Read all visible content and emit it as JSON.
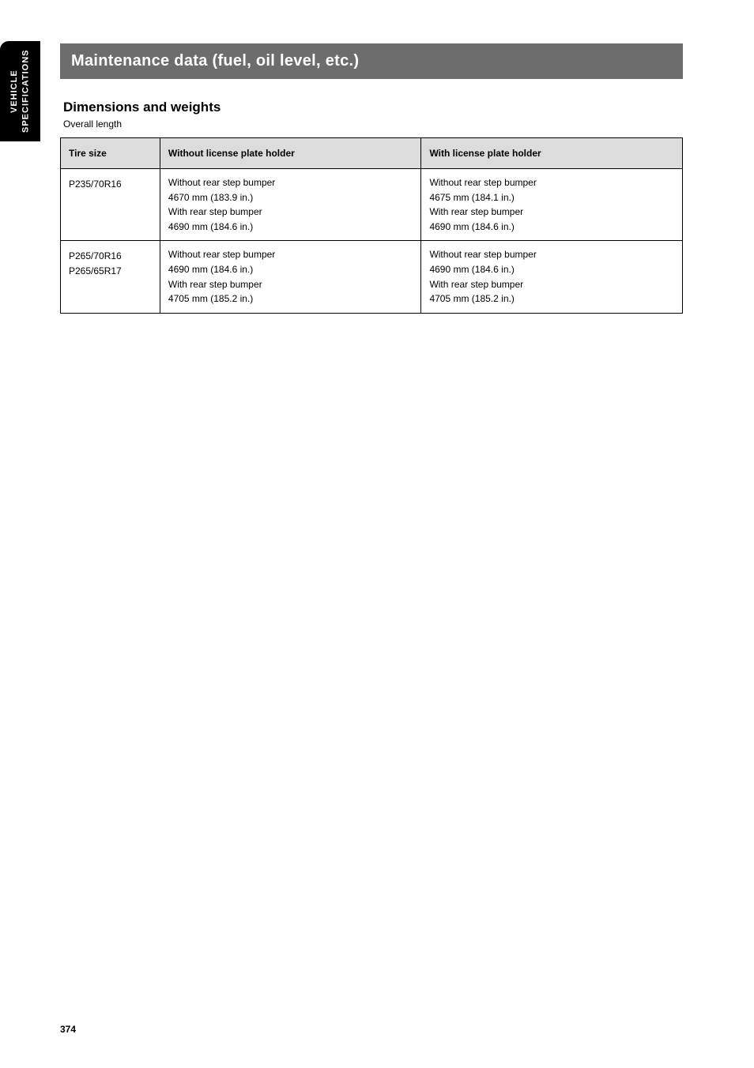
{
  "sideTab": "VEHICLE SPECIFICATIONS",
  "sectionTitle": "Maintenance data (fuel, oil level, etc.)",
  "subtitle": "Dimensions and weights",
  "minor": "Overall length",
  "table": {
    "headers": [
      "Tire size",
      "Without license plate holder",
      "With license plate holder"
    ],
    "rows": [
      {
        "tire": "P235/70R16",
        "without": "Without rear step bumper\n4670 mm (183.9 in.)\nWith rear step bumper\n4690 mm (184.6 in.)",
        "with": "Without rear step bumper\n4675 mm (184.1 in.)\nWith rear step bumper\n4690 mm (184.6 in.)"
      },
      {
        "tire": "P265/70R16\nP265/65R17",
        "without": "Without rear step bumper\n4690 mm (184.6 in.)\nWith rear step bumper\n4705 mm (185.2 in.)",
        "with": "Without rear step bumper\n4690 mm (184.6 in.)\nWith rear step bumper\n4705 mm (185.2 in.)"
      }
    ]
  },
  "pageNumber": "374"
}
